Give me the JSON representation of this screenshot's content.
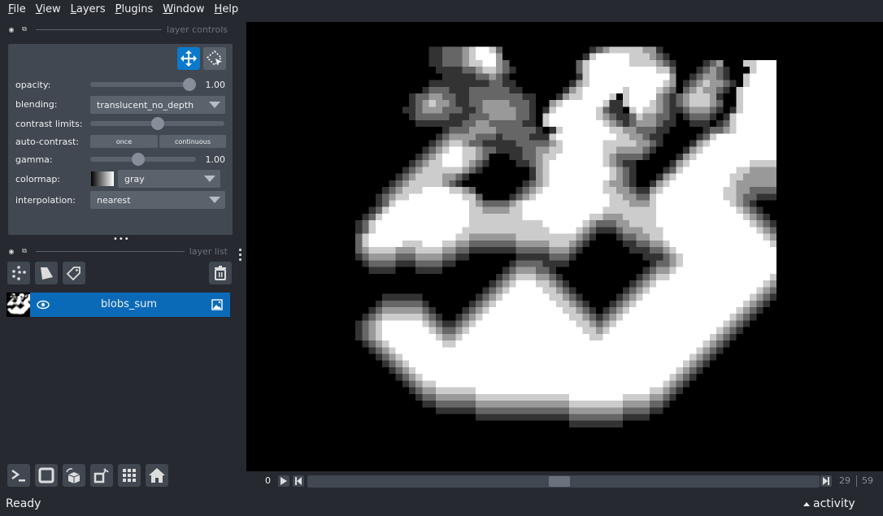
{
  "menu": {
    "items": [
      {
        "label": "File",
        "mnemonic": "F",
        "rest": "ile"
      },
      {
        "label": "View",
        "mnemonic": "V",
        "rest": "iew"
      },
      {
        "label": "Layers",
        "mnemonic": "L",
        "rest": "ayers"
      },
      {
        "label": "Plugins",
        "mnemonic": "P",
        "rest": "lugins"
      },
      {
        "label": "Window",
        "mnemonic": "W",
        "rest": "indow"
      },
      {
        "label": "Help",
        "mnemonic": "H",
        "rest": "elp"
      }
    ]
  },
  "layer_controls": {
    "title": "layer controls",
    "modes": [
      {
        "name": "pan-zoom",
        "icon": "move-arrows-icon",
        "active": true
      },
      {
        "name": "transform",
        "icon": "select-transform-icon",
        "active": false
      }
    ],
    "opacity": {
      "label": "opacity:",
      "value": "1.00",
      "fraction": 1.0
    },
    "blending": {
      "label": "blending:",
      "value": "translucent_no_depth"
    },
    "contrast_limits": {
      "label": "contrast limits:",
      "low_fraction": 0.5
    },
    "auto_contrast": {
      "label": "auto-contrast:",
      "once": "once",
      "continuous": "continuous"
    },
    "gamma": {
      "label": "gamma:",
      "value": "1.00",
      "fraction": 0.45
    },
    "colormap": {
      "label": "colormap:",
      "value": "gray"
    },
    "interpolation": {
      "label": "interpolation:",
      "value": "nearest"
    }
  },
  "layer_list": {
    "title": "layer list",
    "tools": [
      {
        "name": "new-points",
        "icon": "points-icon"
      },
      {
        "name": "new-shapes",
        "icon": "shapes-icon"
      },
      {
        "name": "new-labels",
        "icon": "labels-tag-icon"
      }
    ],
    "delete_icon": "trash-icon",
    "layers": [
      {
        "name": "blobs_sum",
        "visible": true,
        "type_icon": "image-icon",
        "selected": true
      }
    ]
  },
  "bottom_toolbar": [
    {
      "name": "console",
      "icon": "terminal-icon"
    },
    {
      "name": "toggle-ndisplay",
      "icon": "square-icon"
    },
    {
      "name": "roll-dims",
      "icon": "cube-rotate-icon"
    },
    {
      "name": "transpose-dims",
      "icon": "transpose-icon"
    },
    {
      "name": "grid-mode",
      "icon": "grid-icon"
    },
    {
      "name": "reset-view",
      "icon": "home-icon"
    }
  ],
  "dims_slider": {
    "axis_label": "0",
    "current_frame": "29",
    "max_frame": "59",
    "position_fraction": 0.4915
  },
  "status": {
    "text": "Ready",
    "activity_label": "activity"
  },
  "colors": {
    "accent": "#0a7acc",
    "layer_selected": "#0a6ab8",
    "panel_bg": "#262930",
    "control_bg": "#414851"
  },
  "image": {
    "palette": [
      "#000000",
      "#333333",
      "#666666",
      "#999999",
      "#cccccc",
      "#ffffff"
    ],
    "rows": [
      "0000000000000000000000000000000000000000000000000000000000000000",
      "0000000000000000000000000000000000000000000000000000000000000000",
      "0000000000001122234554200000000000001234444433100000000000000000",
      "0000000000001122234555300000000000014555554443210000000000000000",
      "0000000000001122234455320000000000245555554444321000012300044555",
      "0000000000000111122344321000000000245555555555442000123210004555",
      "0000000000000011111223210000000000145555555555553001233210045555",
      "0000000000001111111112211000000001345555555555543012343321045555",
      "0000000000012221112222221100000013455555545555432023433210455555",
      "0000000001223322112222222211000134455554045555321234443100455555",
      "0000000001234332112233332221003455555541145554321234443200455555",
      "0000000011233322211233333221014555555421104544321123332101455555",
      "0000000001222221112223333221045555555432112433221012221014555555",
      "0000000000111111122332222211045555555543212333211001110124555555",
      "0000000000000012223333222222101455555554433222110000012234555555",
      "0000000000000123333222122221114555555555443321100000124555555555",
      "0000000000001234432211111222223455555544444332100001345555555555",
      "0000000000012345544322111122334455555544333321000013455555555555",
      "0000000000123455544320001122344555555543222210000134555555555555",
      "0000000001234455543210000112345555555543211000001345555555554444",
      "0000000012344444432100000001345555555554321000012455555555443333",
      "0000000123444433210000000001345555555554321000134555555554433333",
      "0000001234444432100000000012345555555543321001345555555554333333",
      "0000012344455554432000000123455555555544332113455555555544332222",
      "0000123445555555544200001234555555555554433224555555555544322111",
      "0000124555555555554322223455555555555554443334555555555554321000",
      "0001245555555555554433334455555555555544444444555555555555432100",
      "0012455555555555554444444455555555554433344444555555555555543210",
      "0124555555555555554444444444455555543222334444555555555555554321",
      "0124555555555555544444444444445555432111233344455555555555555432",
      "0245555555555555443333333444444444321000122334455555555555555543",
      "0245555544455544332222222333334443210000011223345555555555555554",
      "0234444333444433221111111222223332100000001112234555555555555555",
      "0123333222333322110000000111112221000000000011123455555555555555",
      "0012222111222211000000001222211110000000000001223455555555555555",
      "0001111000111100000000012333221000000000000012334555555555555555",
      "0000000000000000000000123444332100000000000123445555555555555554",
      "0000000000000000000001234555443210000000001234555555555555555543",
      "0000000000000000000012345555544321000000012345555555555555555432",
      "0000011111100000000123455555554432100000123455555555555555554321",
      "0000122222210000001234555555555443210001234555555555555555543210",
      "0001233333321000012345555555555544321012345555555555555555432100",
      "0012344444432100123455555555555554432123455555555555555554321000",
      "0123455555543211234555555555555555443234555555555555555543210000",
      "0123455555554322345555555555555555544345555555555555555432100000",
      "0123455555555433455555555555555555554455555555555555554321000000",
      "0012345555555544555555555555555555555555555555555555543210000000",
      "0001234555555555555555555555555555555555555555555555432100000000",
      "0000123455555555555555555555555555555555555555555554321000000000",
      "0000012345555555555555555555555555555555555555555543210000000000",
      "0000001234555555555555555555555555555555555555555432100000000000",
      "0000000123455555555555555555555555555555555555554321000000000000",
      "0000000012344555555555555555555555555555555555543210000000000000",
      "0000000001233444444555555555555555555555555554432100000000000000",
      "0000000000122333333444444444444445555555544443321000000000000000",
      "0000000000011222222333333333333334444444433332210000000000000000",
      "0000000000000111111222222222222223333333322221100000000000000000",
      "0000000000000000000111111111111112222222211110000000000000000000",
      "0000000000000000000000000000000001111111100000000000000000000000",
      "0000000000000000000000000000000000000000000000000000000000000000",
      "0000000000000000000000000000000000000000000000000000000000000000",
      "0000000000000000000000000000000000000000000000000000000000000000",
      "0000000000000000000000000000000000000000000000000000000000000000",
      "0000000000000000000000000000000000000000000000000000000000000000"
    ]
  }
}
